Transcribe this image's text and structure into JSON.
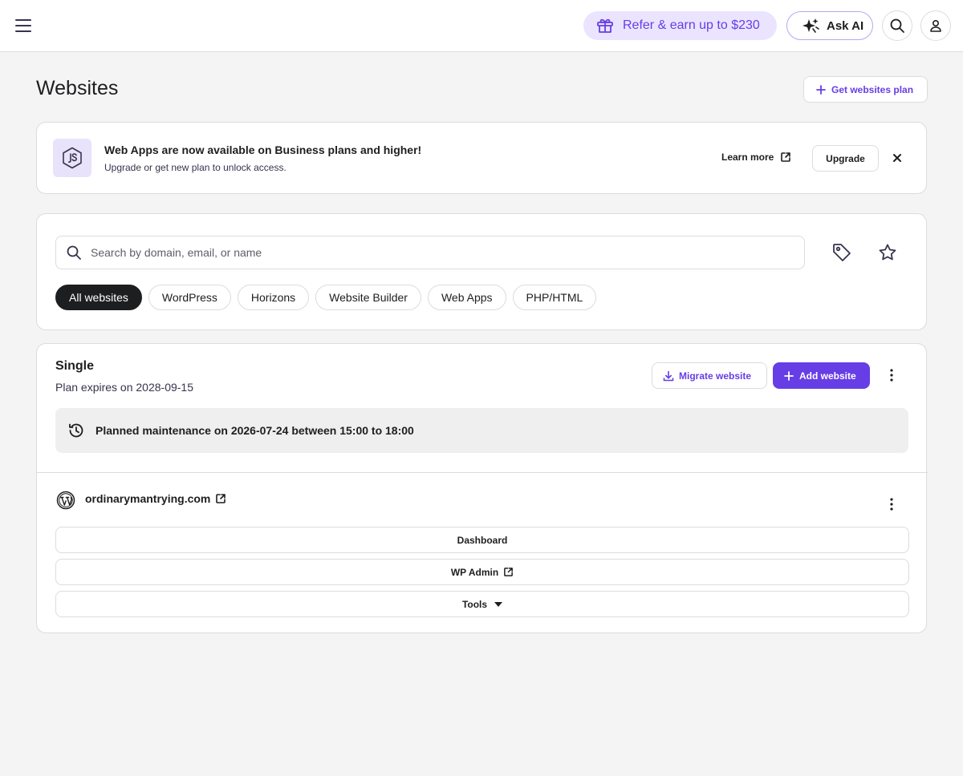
{
  "header": {
    "menu_icon": "hamburger-icon",
    "refer_label": "Refer & earn up to $230",
    "refer_icon": "gift-icon",
    "ask_ai_label": "Ask AI",
    "ask_ai_icon": "sparkle-icon",
    "search_icon": "search-icon",
    "account_icon": "user-icon"
  },
  "page": {
    "title": "Websites",
    "get_plan_label": "Get websites plan"
  },
  "banner": {
    "icon": "nodejs-icon",
    "title": "Web Apps are now available on Business plans and higher!",
    "subtitle": "Upgrade or get new plan to unlock access.",
    "learn_more_label": "Learn more",
    "upgrade_label": "Upgrade"
  },
  "search": {
    "placeholder": "Search by domain, email, or name",
    "value": ""
  },
  "filters": {
    "chips": [
      {
        "label": "All websites",
        "active": true
      },
      {
        "label": "WordPress",
        "active": false
      },
      {
        "label": "Horizons",
        "active": false
      },
      {
        "label": "Website Builder",
        "active": false
      },
      {
        "label": "Web Apps",
        "active": false
      },
      {
        "label": "PHP/HTML",
        "active": false
      }
    ]
  },
  "plan": {
    "name": "Single",
    "expires": "Plan expires on 2028-09-15",
    "migrate_label": "Migrate website",
    "add_label": "Add website",
    "maintenance": "Planned maintenance on 2026-07-24 between 15:00 to 18:00"
  },
  "website": {
    "domain": "ordinarymantrying.com",
    "dashboard_label": "Dashboard",
    "wp_admin_label": "WP Admin",
    "tools_label": "Tools"
  },
  "colors": {
    "accent": "#673de6",
    "accent_light": "#ebe4ff",
    "background": "#f4f4f4",
    "text": "#1d1e20"
  }
}
